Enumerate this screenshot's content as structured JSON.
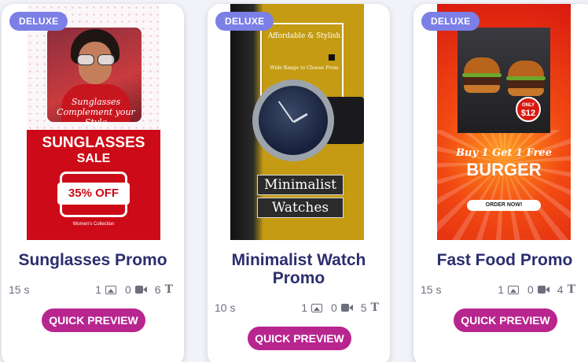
{
  "templates": [
    {
      "badge": "DELUXE",
      "title": "Sunglasses Promo",
      "duration": "15 s",
      "images": "1",
      "videos": "0",
      "texts": "6",
      "button": "QUICK PREVIEW",
      "thumb": {
        "script": "Sunglasses Complement your Style",
        "headline": "SUNGLASSES",
        "subheadline": "SALE",
        "offer": "35% OFF",
        "footer": "Women's Collection"
      }
    },
    {
      "badge": "DELUXE",
      "title": "Minimalist Watch Promo",
      "duration": "10 s",
      "images": "1",
      "videos": "0",
      "texts": "5",
      "button": "QUICK PREVIEW",
      "thumb": {
        "tagline": "Affordable & Stylish",
        "small": "Wide Range to Choose From",
        "label1": "Minimalist",
        "label2": "Watches"
      }
    },
    {
      "badge": "DELUXE",
      "title": "Fast Food Promo",
      "duration": "15 s",
      "images": "1",
      "videos": "0",
      "texts": "4",
      "button": "QUICK PREVIEW",
      "thumb": {
        "price_top": "ONLY",
        "price": "$12",
        "offer": "Buy 1 Get 1 Free",
        "headline": "BURGER",
        "cta": "ORDER NOW!"
      }
    }
  ],
  "icons": {
    "images": "image-icon",
    "videos": "video-camera-icon",
    "texts": "text-icon"
  },
  "colors": {
    "badge": "#7b7fe6",
    "title": "#2a2e6e",
    "button": "#b8258f"
  }
}
